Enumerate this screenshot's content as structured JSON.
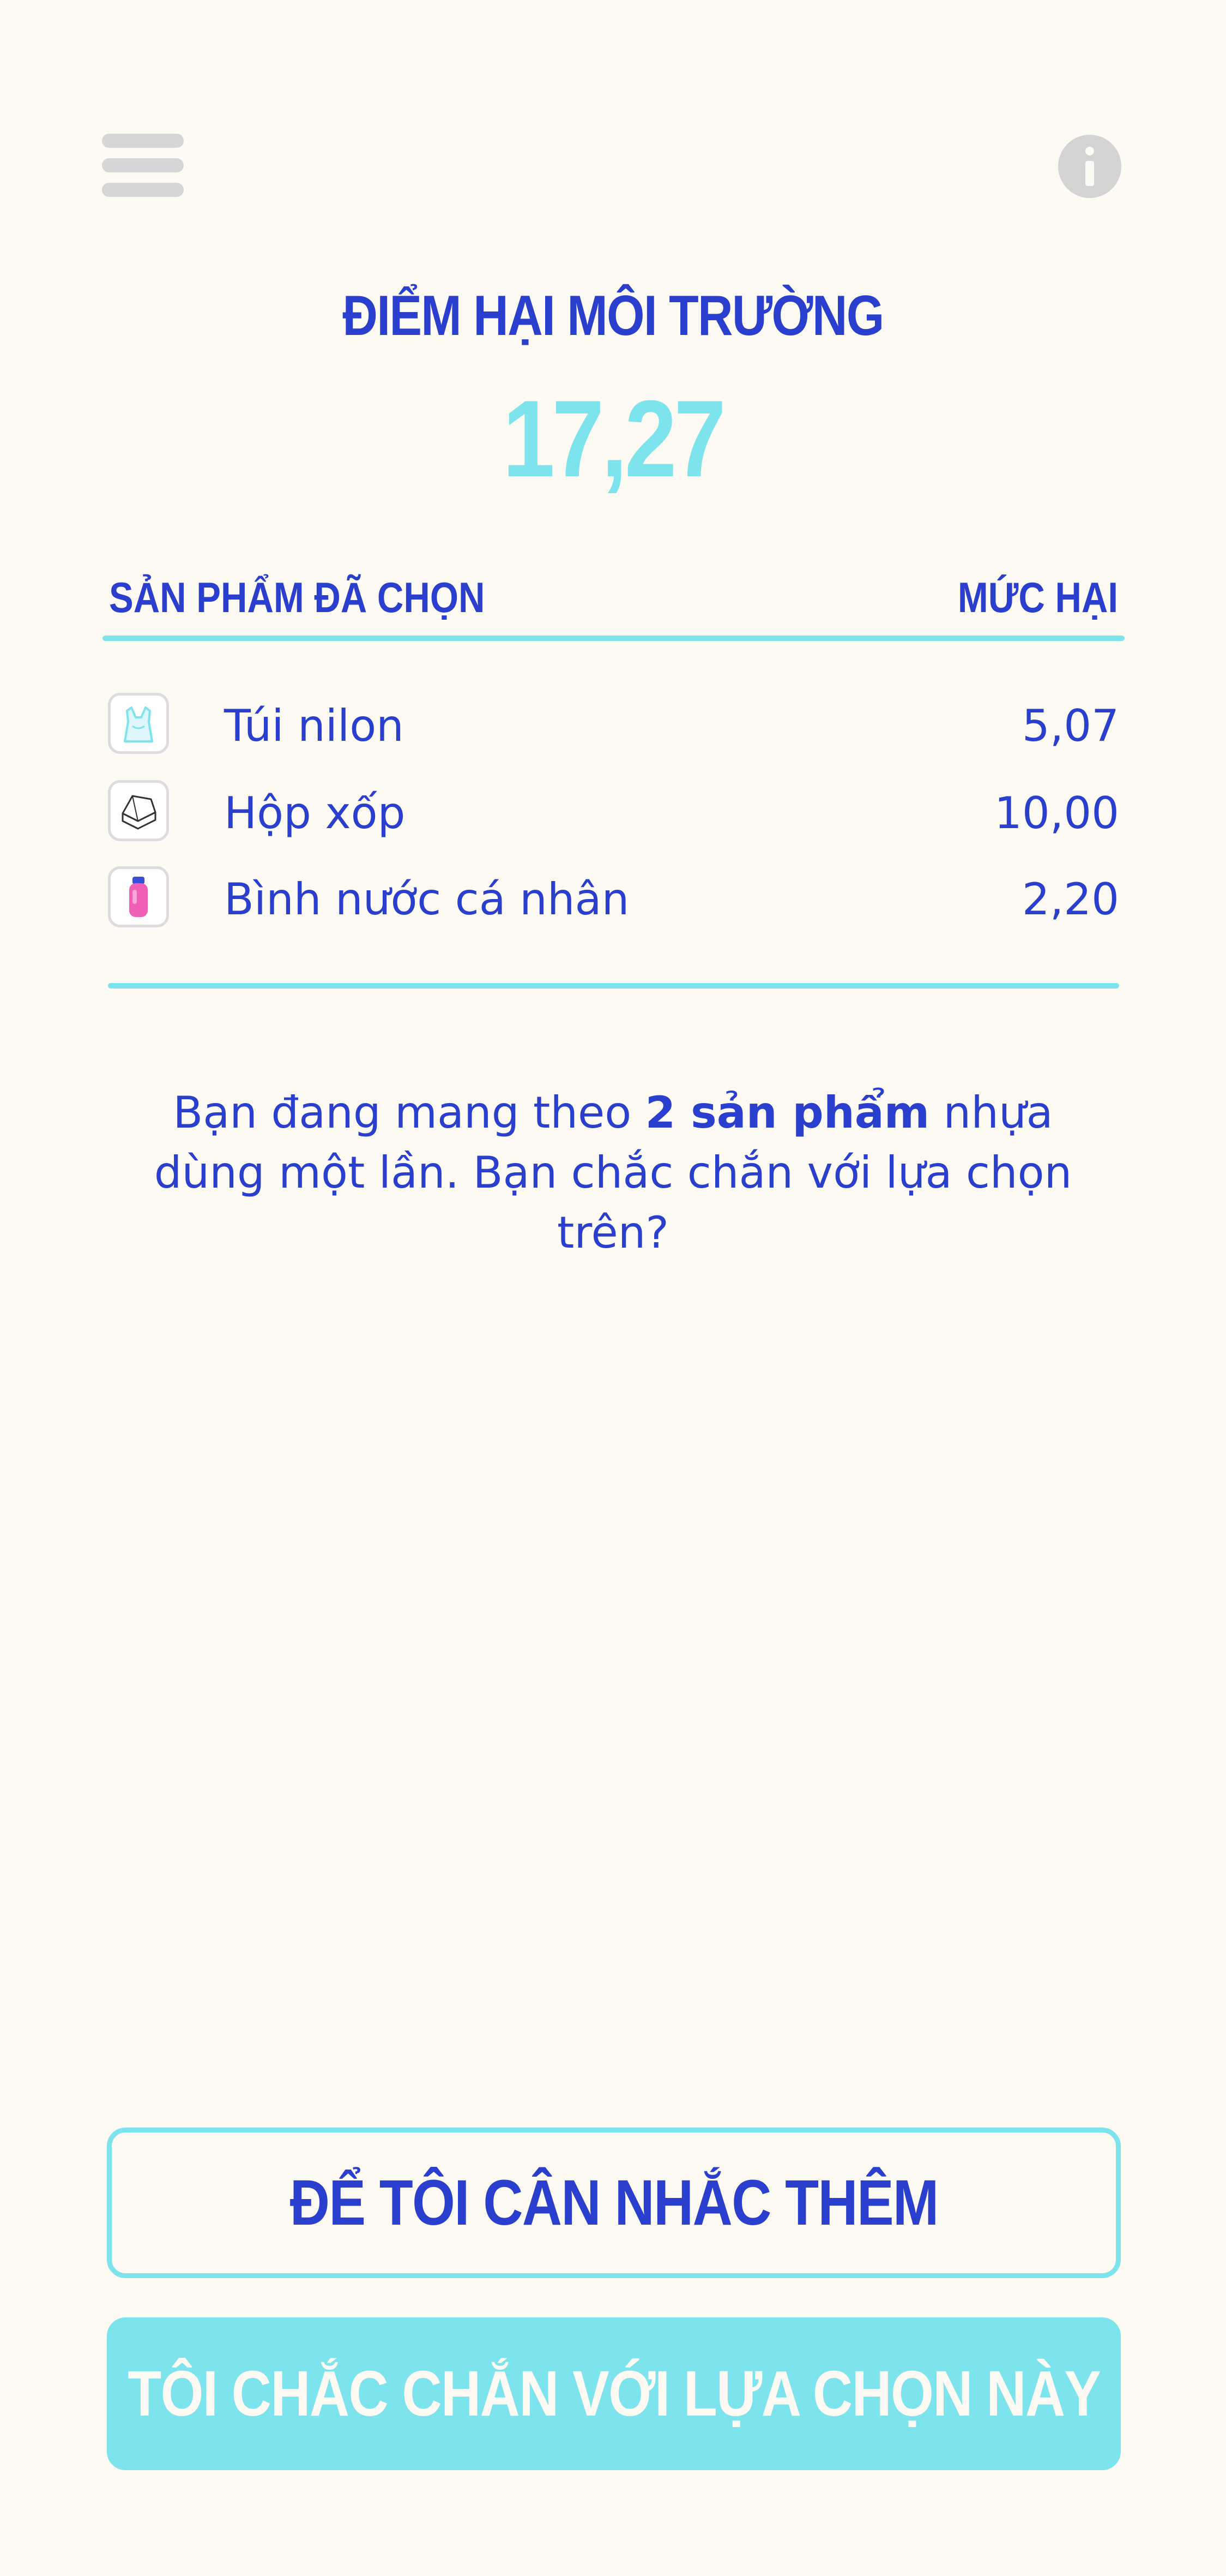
{
  "header": {
    "menu_icon": "hamburger-menu-icon",
    "info_icon": "info-circle-icon"
  },
  "score": {
    "title": "ĐIỂM HẠI MÔI TRƯỜNG",
    "value": "17,27"
  },
  "table": {
    "col_product": "SẢN PHẨM ĐÃ CHỌN",
    "col_harm": "MỨC HẠI",
    "rows": [
      {
        "icon": "plastic-bag-icon",
        "label": "Túi nilon",
        "value": "5,07"
      },
      {
        "icon": "foam-box-icon",
        "label": "Hộp xốp",
        "value": "10,00"
      },
      {
        "icon": "water-bottle-icon",
        "label": "Bình nước cá nhân",
        "value": "2,20"
      }
    ]
  },
  "message": {
    "before": "Bạn đang mang theo ",
    "bold": "2 sản phẩm",
    "after_line1": " nhựa",
    "line2": "dùng một lần. Bạn chắc chắn với lựa chọn trên?"
  },
  "buttons": {
    "reconsider": "ĐỂ TÔI CÂN NHẮC THÊM",
    "confirm": "TÔI CHẮC CHẮN VỚI LỰA CHỌN NÀY"
  },
  "colors": {
    "background": "#fdfaf4",
    "primary_text": "#2b3fcf",
    "accent": "#7de3ec",
    "icon_gray": "#d3d3d3"
  }
}
